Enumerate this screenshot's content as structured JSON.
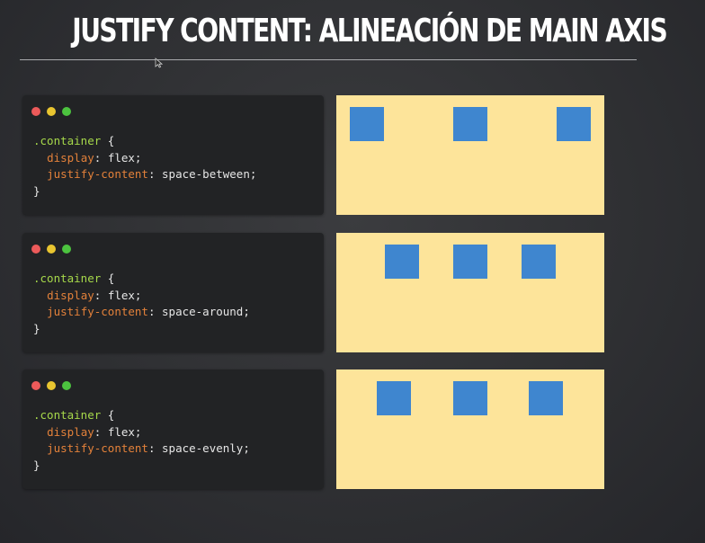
{
  "slide": {
    "title": "JUSTIFY CONTENT: ALINEACIÓN DE MAIN AXIS"
  },
  "examples": [
    {
      "selector": ".container",
      "open_brace": "{",
      "close_brace": "}",
      "display_prop": "display",
      "display_value": "flex;",
      "justify_prop": "justify-content",
      "justify_value": "space-between;"
    },
    {
      "selector": ".container",
      "open_brace": "{",
      "close_brace": "}",
      "display_prop": "display",
      "display_value": "flex;",
      "justify_prop": "justify-content",
      "justify_value": "space-around;"
    },
    {
      "selector": ".container",
      "open_brace": "{",
      "close_brace": "}",
      "display_prop": "display",
      "display_value": "flex;",
      "justify_prop": "justify-content",
      "justify_value": "space-evenly;"
    }
  ],
  "colors": {
    "selector": "#a6d84a",
    "property": "#e3813a",
    "demo_background": "#fde49a",
    "box": "#3f86cf",
    "dot_red": "#ec5a5a",
    "dot_yellow": "#e9c530",
    "dot_green": "#4cc33f"
  }
}
